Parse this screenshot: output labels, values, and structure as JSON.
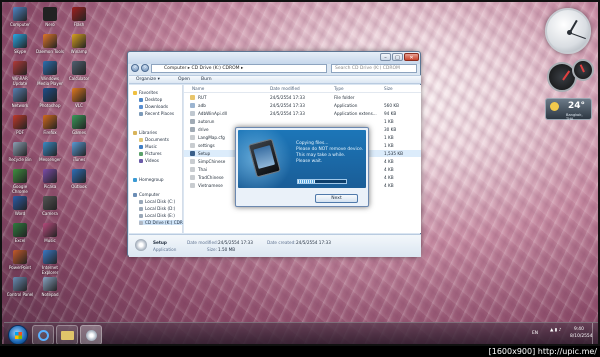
{
  "desktop_icons": [
    {
      "label": "Computer",
      "color": "#4f86c6"
    },
    {
      "label": "Skype",
      "color": "#2aa7e4"
    },
    {
      "label": "WinRAR Update",
      "color": "#b23a3a"
    },
    {
      "label": "Network",
      "color": "#5a7fb0"
    },
    {
      "label": "PDF",
      "color": "#c0392b"
    },
    {
      "label": "Recycle Bin",
      "color": "#8ea0b4"
    },
    {
      "label": "Google Chrome",
      "color": "#3f8f3f"
    },
    {
      "label": "Word",
      "color": "#2b5ca8"
    },
    {
      "label": "Excel",
      "color": "#2f7b3e"
    },
    {
      "label": "PowerPoint",
      "color": "#c55a2b"
    },
    {
      "label": "Control Panel",
      "color": "#6b8db5"
    },
    {
      "label": "Nero",
      "color": "#222222"
    },
    {
      "label": "Daemon Tools",
      "color": "#e0762a"
    },
    {
      "label": "Windows Media Player",
      "color": "#2b6fb0"
    },
    {
      "label": "Photoshop",
      "color": "#1f4e8a"
    },
    {
      "label": "Firefox",
      "color": "#d2691e"
    },
    {
      "label": "Messenger",
      "color": "#3a8ac4"
    },
    {
      "label": "Picasa",
      "color": "#7c4ca8"
    },
    {
      "label": "Camera",
      "color": "#555555"
    },
    {
      "label": "Music",
      "color": "#b54a7c"
    },
    {
      "label": "Internet Explorer",
      "color": "#3a78c4"
    },
    {
      "label": "Notepad",
      "color": "#8aa4c2"
    },
    {
      "label": "Flash",
      "color": "#a02020"
    },
    {
      "label": "Winamp",
      "color": "#d8a020"
    },
    {
      "label": "Calculator",
      "color": "#506070"
    },
    {
      "label": "VLC",
      "color": "#e07820"
    },
    {
      "label": "Games",
      "color": "#3a9a5a"
    },
    {
      "label": "iTunes",
      "color": "#5a9ad4"
    },
    {
      "label": "Outlook",
      "color": "#2f6fb8"
    }
  ],
  "explorer": {
    "address": "Computer ▸ CD Drive (K:) CDROM ▸",
    "search_placeholder": "Search CD Drive (K:) CDROM",
    "toolbar": {
      "organize": "Organize ▾",
      "open": "Open",
      "burn": "Burn"
    },
    "nav": {
      "favorites_header": "Favorites",
      "favorites": [
        "Desktop",
        "Downloads",
        "Recent Places"
      ],
      "libraries_header": "Libraries",
      "libraries": [
        "Documents",
        "Music",
        "Pictures",
        "Videos"
      ],
      "homegroup": "Homegroup",
      "computer_header": "Computer",
      "drives": [
        "Local Disk (C:)",
        "Local Disk (D:)",
        "Local Disk (E:)",
        "CD Drive (K:) CDR"
      ]
    },
    "columns": {
      "name": "Name",
      "date": "Date modified",
      "type": "Type",
      "size": "Size"
    },
    "files": [
      {
        "name": "RUT",
        "date": "24/5/2554 17:33",
        "type": "File folder",
        "size": "",
        "color": "#e8c56b"
      },
      {
        "name": "adb",
        "date": "24/5/2554 17:33",
        "type": "Application",
        "size": "560 KB",
        "color": "#9bb4d0"
      },
      {
        "name": "AdbWinApi.dll",
        "date": "24/5/2554 17:33",
        "type": "Application extens...",
        "size": "94 KB",
        "color": "#c0c8d0"
      },
      {
        "name": "autorun",
        "date": "",
        "type": "",
        "size": "1 KB",
        "color": "#a0aab4"
      },
      {
        "name": "drive",
        "date": "",
        "type": "",
        "size": "30 KB",
        "color": "#a0aab4"
      },
      {
        "name": "LangMap.cfg",
        "date": "",
        "type": "",
        "size": "1 KB",
        "color": "#c8ccd0"
      },
      {
        "name": "settings",
        "date": "",
        "type": "",
        "size": "1 KB",
        "color": "#c8ccd0"
      },
      {
        "name": "Setup",
        "date": "",
        "type": "",
        "size": "1,535 KB",
        "color": "#3a5f8a"
      },
      {
        "name": "SimpChinese",
        "date": "",
        "type": "",
        "size": "4 KB",
        "color": "#c8ccd0"
      },
      {
        "name": "Thai",
        "date": "",
        "type": "",
        "size": "4 KB",
        "color": "#c8ccd0"
      },
      {
        "name": "TradChinese",
        "date": "",
        "type": "",
        "size": "4 KB",
        "color": "#c8ccd0"
      },
      {
        "name": "Vietnamese",
        "date": "",
        "type": "",
        "size": "4 KB",
        "color": "#c8ccd0"
      }
    ],
    "details": {
      "name": "Setup",
      "kind": "Application",
      "date_modified_label": "Date modified:",
      "date_modified": "24/5/2554 17:33",
      "date_created_label": "Date created:",
      "date_created": "24/5/2554 17:33",
      "size_label": "Size:",
      "size": "1.50 MB"
    }
  },
  "dialog": {
    "lines": [
      "Copying files...",
      "Please do NOT remove device.",
      "This may take a while.",
      "Please wait."
    ],
    "progress": 0.35,
    "next_label": "Next"
  },
  "gadgets": {
    "weather_temp": "24°",
    "weather_city": "Bangkok, THA"
  },
  "taskbar": {
    "lang": "EN",
    "time": "9:40",
    "date": "8/10/2554"
  },
  "watermark": "[1600x900] http://upic.me/"
}
